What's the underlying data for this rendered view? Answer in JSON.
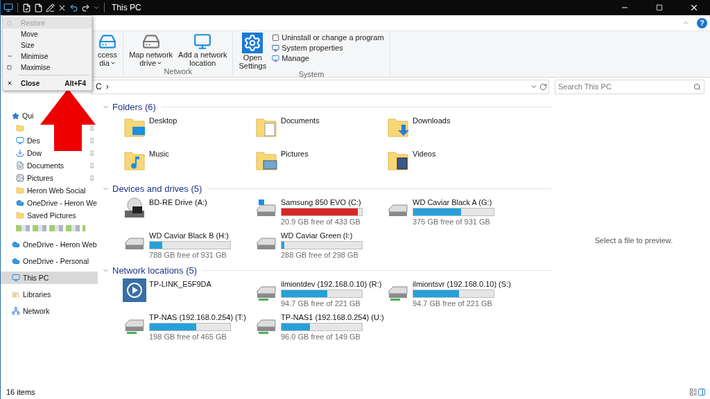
{
  "window": {
    "title": "This PC"
  },
  "help": "?",
  "ribbon": {
    "groups": [
      {
        "buttons": [
          {
            "kind": "media",
            "lines": [
              "ccess",
              "dia"
            ],
            "dropdown": true
          }
        ]
      },
      {
        "name": "Network",
        "buttons": [
          {
            "kind": "map-drive",
            "lines": [
              "Map network",
              "drive"
            ],
            "dropdown": true
          },
          {
            "kind": "add-location",
            "lines": [
              "Add a network",
              "location"
            ],
            "dropdown": false
          }
        ]
      },
      {
        "name": "System",
        "buttons": [
          {
            "kind": "settings",
            "lines": [
              "Open",
              "Settings"
            ],
            "dropdown": false
          }
        ],
        "small": [
          {
            "kind": "uninstall",
            "label": "Uninstall or change a program"
          },
          {
            "kind": "properties",
            "label": "System properties"
          },
          {
            "kind": "manage",
            "label": "Manage"
          }
        ]
      }
    ]
  },
  "address": {
    "crumb": "C",
    "separator": "›"
  },
  "search": {
    "placeholder": "Search This PC"
  },
  "sidebar": {
    "items": [
      {
        "kind": "star",
        "label": "Qui",
        "selected": false,
        "pinned": false,
        "children": [
          {
            "kind": "folder",
            "selected": false,
            "pinned": true
          },
          {
            "kind": "desktop",
            "label": "Des",
            "selected": false,
            "pinned": true
          },
          {
            "kind": "download",
            "label": "Dow",
            "selected": false,
            "pinned": true
          },
          {
            "kind": "documents",
            "label": "Documents",
            "selected": false,
            "pinned": true
          },
          {
            "kind": "pictures",
            "label": "Pictures",
            "selected": false,
            "pinned": true
          },
          {
            "kind": "folder",
            "label": "Heron Web Social",
            "selected": false,
            "pinned": false
          },
          {
            "kind": "onedrive",
            "label": "OneDrive - Heron We",
            "selected": false,
            "pinned": false
          },
          {
            "kind": "folder",
            "label": "Saved Pictures",
            "selected": false,
            "pinned": false
          },
          {
            "kind": "blurred",
            "selected": false,
            "pinned": false
          }
        ]
      },
      {
        "kind": "onedrive",
        "label": "OneDrive - Heron Web",
        "selected": false,
        "pinned": false
      },
      {
        "kind": "onedrive",
        "label": "OneDrive - Personal",
        "selected": false,
        "pinned": false
      },
      {
        "kind": "thispc",
        "label": "This PC",
        "selected": true,
        "pinned": false
      },
      {
        "kind": "libraries",
        "label": "Libraries",
        "selected": false,
        "pinned": false
      },
      {
        "kind": "network",
        "label": "Network",
        "selected": false,
        "pinned": false
      }
    ]
  },
  "groups": [
    {
      "title": "Folders (6)",
      "items": [
        {
          "kind": "desktop",
          "name": "Desktop"
        },
        {
          "kind": "documents",
          "name": "Documents"
        },
        {
          "kind": "download",
          "name": "Downloads"
        },
        {
          "kind": "music",
          "name": "Music"
        },
        {
          "kind": "pictures",
          "name": "Pictures"
        },
        {
          "kind": "videos",
          "name": "Videos"
        }
      ]
    },
    {
      "title": "Devices and drives (5)",
      "items": [
        {
          "kind": "optical",
          "name": "BD-RE Drive (A:)"
        },
        {
          "kind": "system",
          "name": "Samsung 850 EVO (C:)",
          "level": 0.952,
          "color": "#da2626",
          "free": "20.9 GB free of 433 GB"
        },
        {
          "kind": "hdd",
          "name": "WD Caviar Black A (G:)",
          "level": 0.597,
          "color": "#26a0da",
          "free": "375 GB free of 931 GB"
        },
        {
          "kind": "hdd",
          "name": "WD Caviar Black B (H:)",
          "level": 0.154,
          "color": "#26a0da",
          "free": "788 GB free of 931 GB"
        },
        {
          "kind": "hdd",
          "name": "WD Caviar Green (I:)",
          "level": 0.034,
          "color": "#26a0da",
          "free": "288 GB free of 298 GB"
        }
      ]
    },
    {
      "title": "Network locations (5)",
      "items": [
        {
          "kind": "media-server",
          "name": "TP-LINK_E5F9DA"
        },
        {
          "kind": "net-drive",
          "name": "ilmiontdev (192.168.0.10) (R:)",
          "level": 0.571,
          "color": "#26a0da",
          "free": "94.7 GB free of 221 GB"
        },
        {
          "kind": "net-drive",
          "name": "ilmiontsvr (192.168.0.10) (S:)",
          "level": 0.571,
          "color": "#26a0da",
          "free": "94.7 GB free of 221 GB"
        },
        {
          "kind": "net-drive",
          "name": "TP-NAS (192.168.0.254) (T:)",
          "level": 0.574,
          "color": "#26a0da",
          "free": "198 GB free of 465 GB"
        },
        {
          "kind": "net-drive",
          "name": "TP-NAS1 (192.168.0.254) (U:)",
          "level": 0.356,
          "color": "#26a0da",
          "free": "96.0 GB free of 149 GB"
        }
      ]
    }
  ],
  "preview": {
    "message": "Select a file to preview."
  },
  "status_bar": {
    "count": "16 items"
  },
  "system_menu": {
    "items": [
      {
        "kind": "restore",
        "label": "Restore",
        "disabled": true
      },
      {
        "kind": "plain",
        "label": "Move",
        "disabled": false
      },
      {
        "kind": "plain",
        "label": "Size",
        "disabled": false
      },
      {
        "kind": "minimise",
        "label": "Minimise",
        "disabled": false
      },
      {
        "kind": "maximise",
        "label": "Maximise",
        "disabled": false
      },
      {
        "kind": "separator"
      },
      {
        "kind": "close",
        "label": "Close",
        "shortcut": "Alt+F4",
        "disabled": false,
        "bold": true
      }
    ]
  }
}
